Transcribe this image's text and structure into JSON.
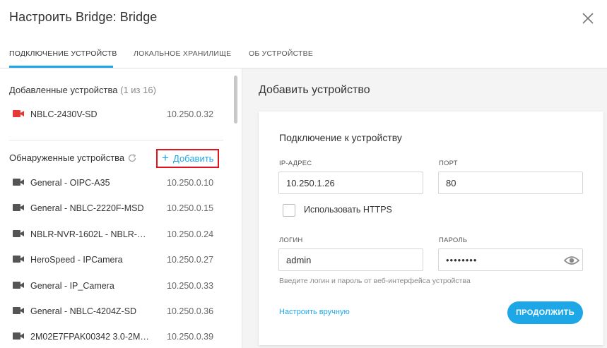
{
  "dialog": {
    "title": "Настроить Bridge: Bridge"
  },
  "tabs": [
    {
      "label": "Подключение устройств",
      "active": true
    },
    {
      "label": "Локальное хранилище",
      "active": false
    },
    {
      "label": "Об устройстве",
      "active": false
    }
  ],
  "added_devices": {
    "title": "Добавленные устройства",
    "count": "(1 из 16)",
    "items": [
      {
        "name": "NBLC-2430V-SD",
        "ip": "10.250.0.32",
        "icon": "camera-icon-red"
      }
    ]
  },
  "discovered_devices": {
    "title": "Обнаруженные устройства",
    "add_label": "Добавить",
    "items": [
      {
        "name": "General - OIPC-A35",
        "ip": "10.250.0.10"
      },
      {
        "name": "General - NBLC-2220F-MSD",
        "ip": "10.250.0.15"
      },
      {
        "name": "NBLR-NVR-1602L - NBLR-NV...",
        "ip": "10.250.0.24"
      },
      {
        "name": "HeroSpeed - IPCamera",
        "ip": "10.250.0.27"
      },
      {
        "name": "General - IP_Camera",
        "ip": "10.250.0.33"
      },
      {
        "name": "General - NBLC-4204Z-SD",
        "ip": "10.250.0.36"
      },
      {
        "name": "2M02E7FPAK00342 3.0-2M0...",
        "ip": "10.250.0.39"
      }
    ]
  },
  "add_device": {
    "title": "Добавить устройство",
    "card_title": "Подключение к устройству",
    "ip_label": "IP-адрес",
    "ip_value": "10.250.1.26",
    "port_label": "Порт",
    "port_value": "80",
    "https_label": "Использовать HTTPS",
    "login_label": "Логин",
    "login_value": "admin",
    "password_label": "Пароль",
    "password_value": "••••••••",
    "hint": "Введите логин и пароль от веб-интерфейса устройства",
    "manual_link": "Настроить вручную",
    "continue_label": "Продолжить"
  },
  "colors": {
    "accent": "#1ea7e7",
    "highlight_border": "#e0131f",
    "camera_red": "#e53935",
    "camera_gray": "#555555"
  }
}
